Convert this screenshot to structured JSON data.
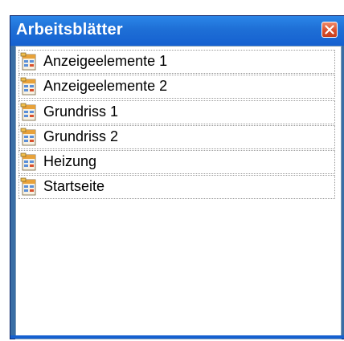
{
  "panel": {
    "title": "Arbeitsblätter",
    "close_icon": "close-icon",
    "accent_color": "#1e6fd6",
    "close_color": "#d9502d"
  },
  "sheets": [
    {
      "label": "Anzeigeelemente 1",
      "icon": "worksheet-icon"
    },
    {
      "label": "Anzeigeelemente 2",
      "icon": "worksheet-icon"
    },
    {
      "label": "Grundriss 1",
      "icon": "worksheet-icon"
    },
    {
      "label": "Grundriss 2",
      "icon": "worksheet-icon"
    },
    {
      "label": "Heizung",
      "icon": "worksheet-icon"
    },
    {
      "label": "Startseite",
      "icon": "worksheet-icon"
    }
  ]
}
